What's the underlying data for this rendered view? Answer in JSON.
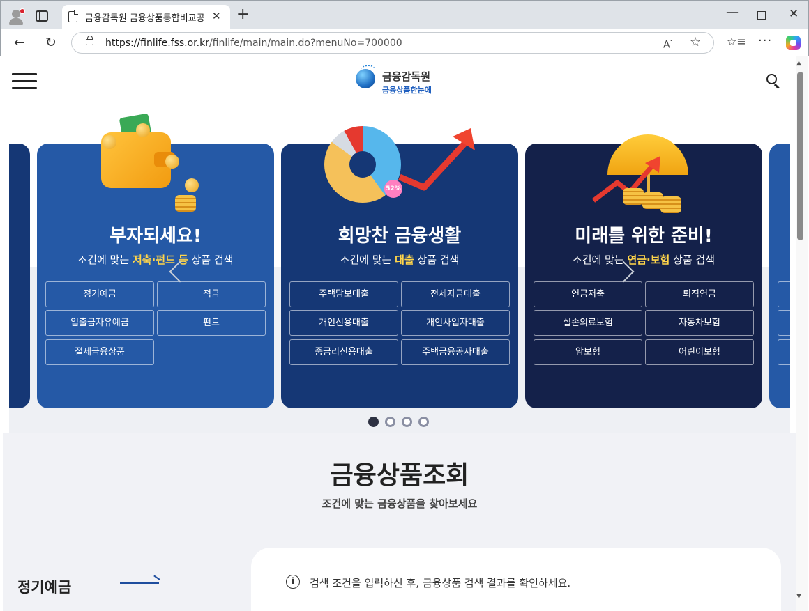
{
  "browser": {
    "tab_title": "금융감독원 금융상품통합비교공시",
    "url_host": "https://finlife.fss.or.kr",
    "url_path": "/finlife/main/main.do?menuNo=700000",
    "icons": [
      "profile-icon",
      "tabs-icon",
      "document-icon",
      "close-icon",
      "plus-icon",
      "minimize-icon",
      "maximize-icon",
      "back-icon",
      "reload-icon",
      "lock-icon",
      "read-aloud-icon",
      "star-icon",
      "favorites-icon",
      "more-icon",
      "copilot-icon"
    ]
  },
  "header": {
    "logo_name": "금융감독원",
    "logo_tagline": "금융상품한눈에",
    "icons": [
      "hamburger-menu-icon",
      "search-icon"
    ]
  },
  "carousel": {
    "cards": [
      {
        "title": "부자되세요!",
        "sub_pre": "조건에 맞는 ",
        "sub_highlight": "저축·펀드 등",
        "sub_post": " 상품 검색",
        "buttons": [
          "정기예금",
          "적금",
          "입출금자유예금",
          "펀드",
          "절세금융상품"
        ]
      },
      {
        "title": "희망찬 금융생활",
        "sub_pre": "조건에 맞는 ",
        "sub_highlight": "대출",
        "sub_post": " 상품 검색",
        "badge": "52%",
        "buttons": [
          "주택담보대출",
          "전세자금대출",
          "개인신용대출",
          "개인사업자대출",
          "중금리신용대출",
          "주택금융공사대출"
        ]
      },
      {
        "title": "미래를 위한 준비!",
        "sub_pre": "조건에 맞는 ",
        "sub_highlight": "연금·보험",
        "sub_post": " 상품 검색",
        "buttons": [
          "연금저축",
          "퇴직연금",
          "실손의료보험",
          "자동차보험",
          "암보험",
          "어린이보험"
        ]
      }
    ],
    "pagination_count": 4,
    "active_page": 1
  },
  "main": {
    "section_title": "금융상품조회",
    "section_subtitle": "조건에 맞는 금융상품을 찾아보세요",
    "side_label": "정기예금",
    "info_text": "검색 조건을 입력하신 후, 금융상품 검색 결과를 확인하세요."
  },
  "colors": {
    "card_light": "#2559a6",
    "card_mid": "#153775",
    "card_dark": "#14214a",
    "highlight": "#ffd54a",
    "page_bg": "#f1f2f6"
  }
}
